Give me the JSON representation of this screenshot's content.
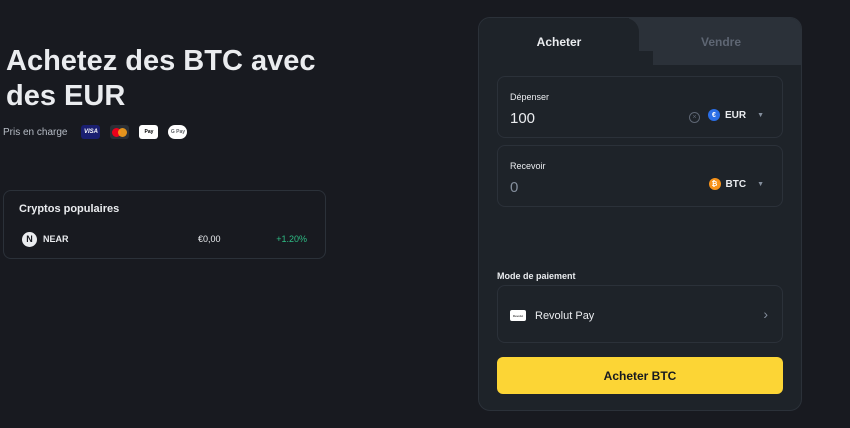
{
  "hero": {
    "title": "Achetez des BTC avec des EUR",
    "supported_label": "Pris en charge",
    "payment_badges": [
      "VISA",
      "Mastercard",
      "Apple Pay",
      "Google Pay"
    ],
    "badge_texts": {
      "visa": "VISA",
      "apple": "Pay",
      "google": "G Pay"
    }
  },
  "popular": {
    "title": "Cryptos populaires",
    "items": [
      {
        "symbol": "NEAR",
        "logo_letter": "N",
        "price": "€0,00",
        "change": "+1.20%"
      }
    ]
  },
  "trade": {
    "tabs": [
      {
        "label": "Acheter",
        "active": true
      },
      {
        "label": "Vendre",
        "active": false
      }
    ],
    "spend": {
      "label": "Dépenser",
      "value": "100",
      "currency": "EUR",
      "currency_symbol": "€",
      "clear_icon": "×"
    },
    "receive": {
      "label": "Recevoir",
      "value": "0",
      "currency": "BTC",
      "currency_symbol": "₿"
    },
    "payment_method": {
      "label": "Mode de paiement",
      "name": "Revolut Pay",
      "icon_text": "Revolut"
    },
    "submit_label": "Acheter BTC"
  },
  "colors": {
    "background": "#181a20",
    "panel": "#1e2329",
    "accent": "#fcd535",
    "positive": "#2ebd85"
  }
}
